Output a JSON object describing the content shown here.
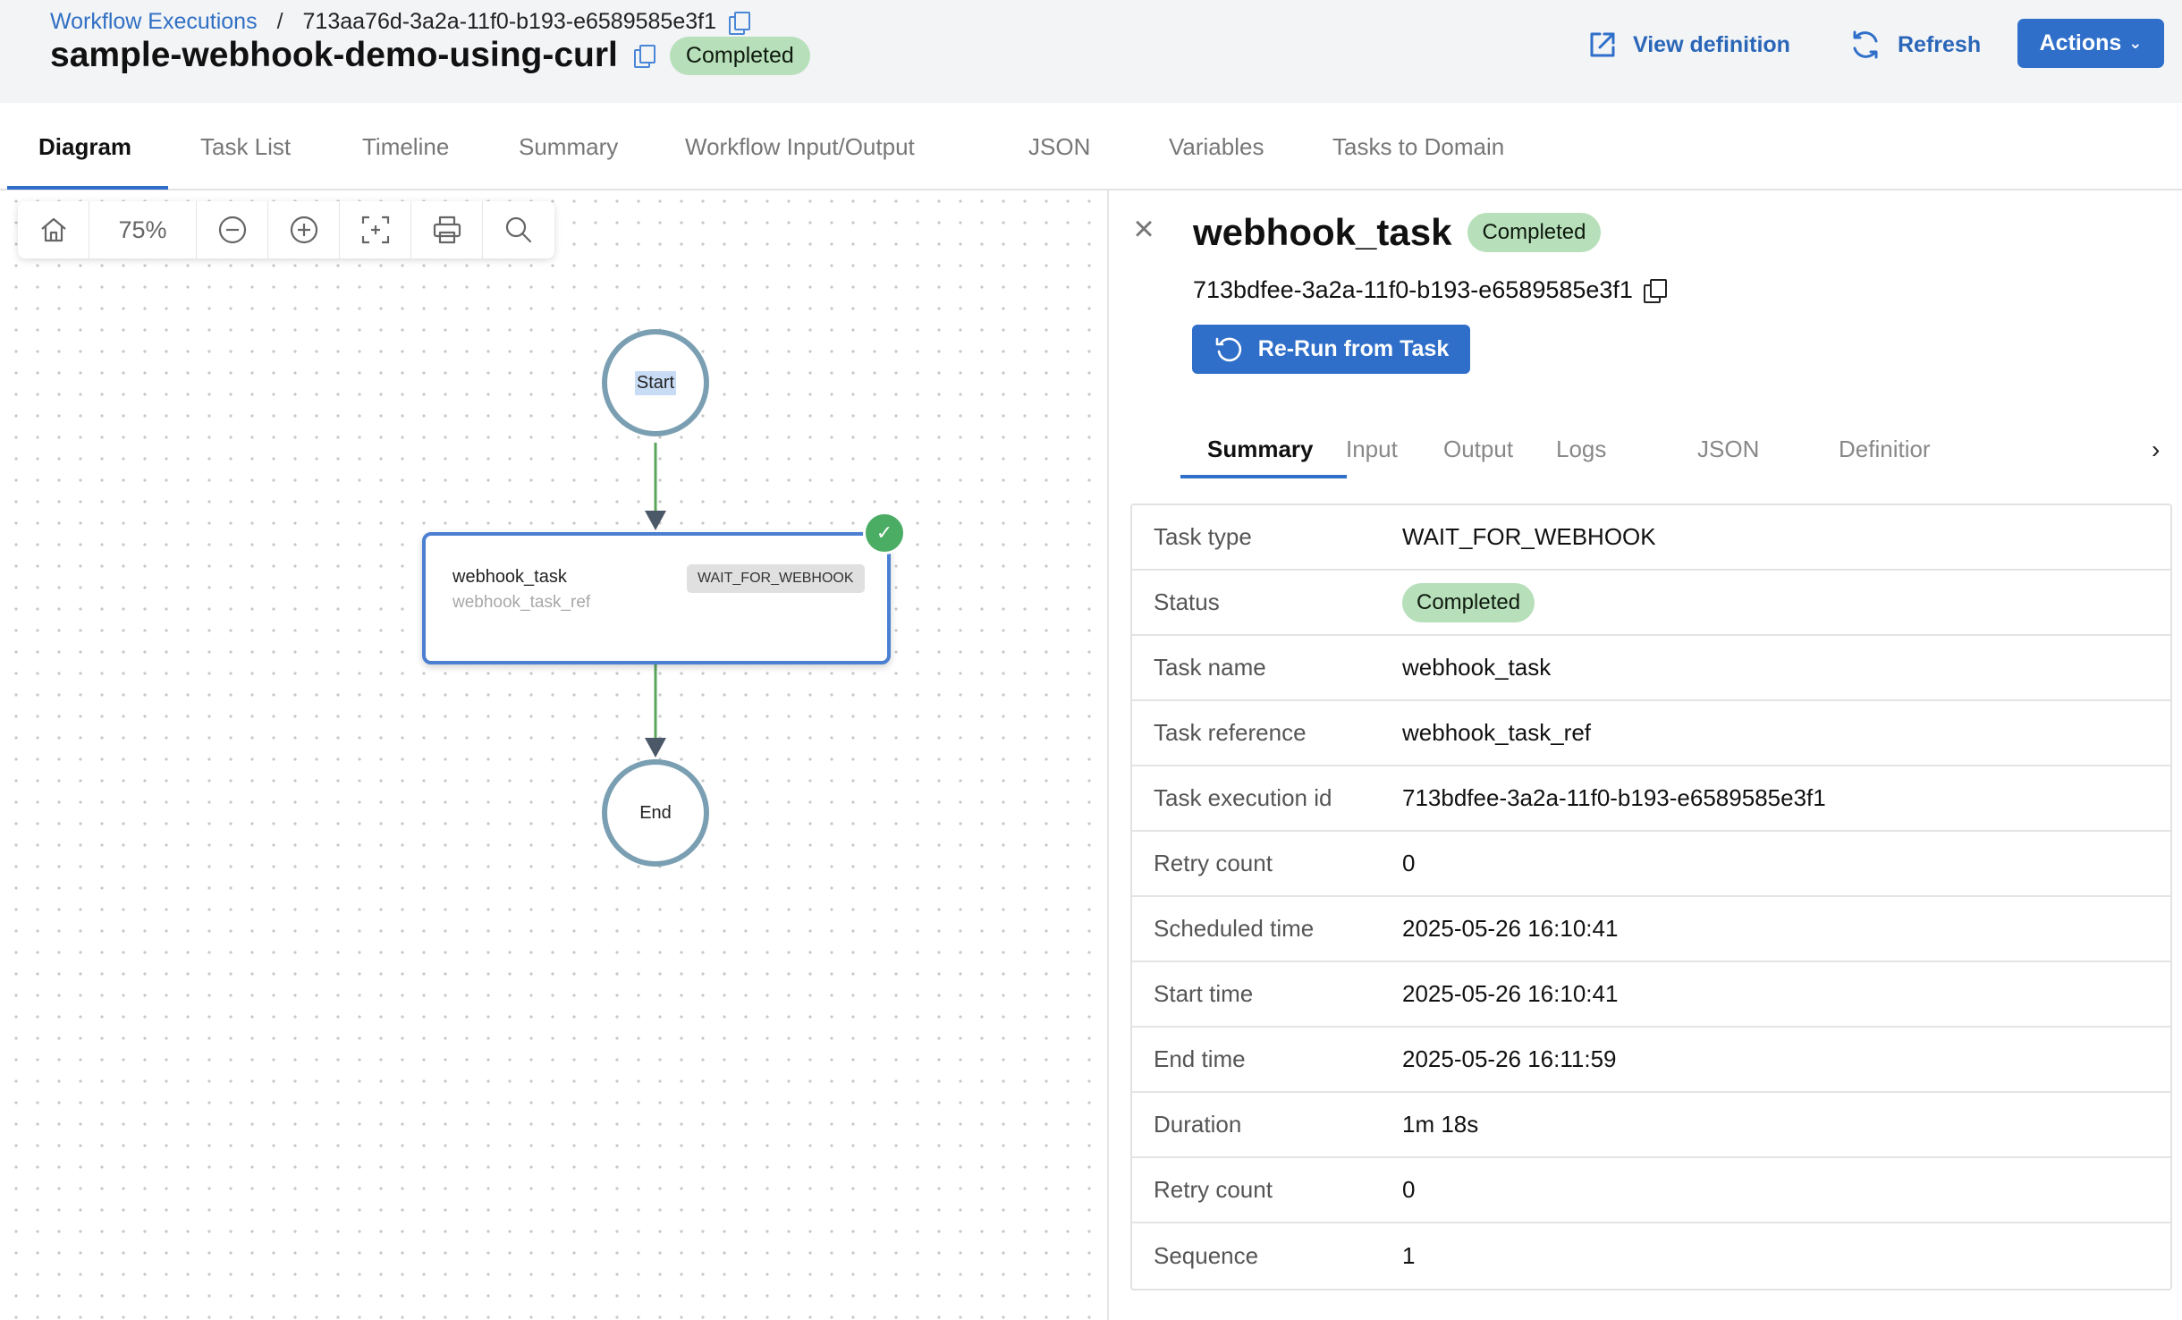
{
  "breadcrumb": {
    "parent": "Workflow Executions",
    "separator": "/",
    "current": "713aa76d-3a2a-11f0-b193-e6589585e3f1"
  },
  "workflow": {
    "title": "sample-webhook-demo-using-curl",
    "status": "Completed"
  },
  "header_actions": {
    "view_definition": "View definition",
    "refresh": "Refresh",
    "actions": "Actions"
  },
  "main_tabs": [
    {
      "label": "Diagram",
      "active": true
    },
    {
      "label": "Task List"
    },
    {
      "label": "Timeline"
    },
    {
      "label": "Summary"
    },
    {
      "label": "Workflow Input/Output"
    },
    {
      "label": "JSON"
    },
    {
      "label": "Variables"
    },
    {
      "label": "Tasks to Domain"
    }
  ],
  "toolbar": {
    "zoom": "75%",
    "icons": [
      "home-icon",
      "zoom-out-icon",
      "zoom-in-icon",
      "fit-view-icon",
      "print-icon",
      "search-icon"
    ]
  },
  "diagram": {
    "start_label": "Start",
    "end_label": "End",
    "task": {
      "name": "webhook_task",
      "ref": "webhook_task_ref",
      "type": "WAIT_FOR_WEBHOOK",
      "status_icon": "check-icon"
    }
  },
  "colors": {
    "accent": "#2f6fc9",
    "success_badge": "#b7dfba",
    "edge": "#5aa55a",
    "node_border": "#7b9fb2"
  },
  "task_panel": {
    "title": "webhook_task",
    "status": "Completed",
    "execution_id": "713bdfee-3a2a-11f0-b193-e6589585e3f1",
    "rerun_label": "Re-Run from Task",
    "tabs": [
      {
        "label": "Summary",
        "active": true
      },
      {
        "label": "Input"
      },
      {
        "label": "Output"
      },
      {
        "label": "Logs"
      },
      {
        "label": "JSON"
      },
      {
        "label": "Definitior"
      }
    ],
    "properties": [
      {
        "key": "Task type",
        "value": "WAIT_FOR_WEBHOOK"
      },
      {
        "key": "Status",
        "value": "Completed"
      },
      {
        "key": "Task name",
        "value": "webhook_task"
      },
      {
        "key": "Task reference",
        "value": "webhook_task_ref"
      },
      {
        "key": "Task execution id",
        "value": "713bdfee-3a2a-11f0-b193-e6589585e3f1"
      },
      {
        "key": "Retry count",
        "value": "0"
      },
      {
        "key": "Scheduled time",
        "value": "2025-05-26 16:10:41"
      },
      {
        "key": "Start time",
        "value": "2025-05-26 16:10:41"
      },
      {
        "key": "End time",
        "value": "2025-05-26 16:11:59"
      },
      {
        "key": "Duration",
        "value": "1m 18s"
      },
      {
        "key": "Retry count",
        "value": "0"
      },
      {
        "key": "Sequence",
        "value": "1"
      }
    ]
  }
}
